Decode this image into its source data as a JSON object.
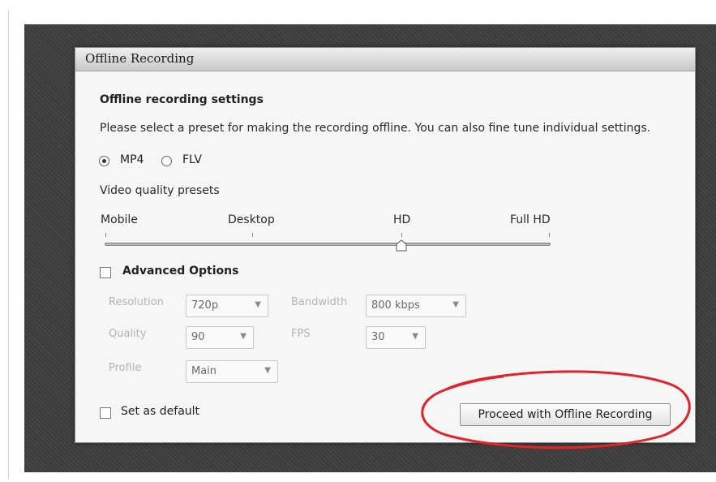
{
  "dialog": {
    "title": "Offline Recording",
    "heading": "Offline recording settings",
    "description": "Please select a preset for making the recording offline. You can also fine tune individual settings.",
    "format_options": [
      {
        "label": "MP4",
        "selected": true
      },
      {
        "label": "FLV",
        "selected": false
      }
    ],
    "quality_label": "Video quality presets",
    "quality_presets": [
      "Mobile",
      "Desktop",
      "HD",
      "Full HD"
    ],
    "quality_selected": "HD",
    "advanced": {
      "label": "Advanced Options",
      "checked": false,
      "resolution_label": "Resolution",
      "resolution_value": "720p",
      "bandwidth_label": "Bandwidth",
      "bandwidth_value": "800 kbps",
      "quality_label": "Quality",
      "quality_value": "90",
      "fps_label": "FPS",
      "fps_value": "30",
      "profile_label": "Profile",
      "profile_value": "Main"
    },
    "set_default": {
      "label": "Set as default",
      "checked": false
    },
    "proceed_label": "Proceed with Offline Recording"
  },
  "colors": {
    "annotation_circle": "#e0242a",
    "backdrop": "#3e3e3e",
    "dialog_bg": "#f6f6f6"
  },
  "icons": {
    "dropdown": "chevron-down-icon",
    "slider_thumb": "slider-thumb-icon"
  }
}
